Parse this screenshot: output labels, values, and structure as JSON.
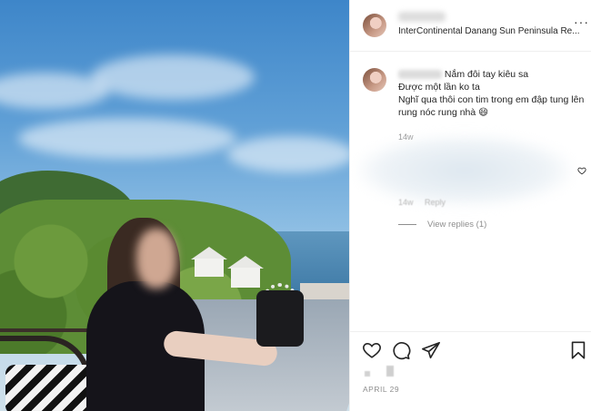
{
  "post": {
    "author": {
      "location": "InterContinental Danang Sun Peninsula Re..."
    },
    "more_label": "···",
    "caption": {
      "lines": [
        "Nắm đôi tay kiêu sa",
        "Được một lần ko ta",
        "Nghĩ qua thôi con tim trong em đập tung lên rung nóc rung nhà 😄"
      ],
      "time": "14w"
    },
    "comment": {
      "time": "14w",
      "reply_label": "Reply"
    },
    "view_replies_label": "View replies (1)",
    "date": "APRIL 29",
    "icons": {
      "like": "heart-icon",
      "comment": "comment-icon",
      "share": "share-icon",
      "save": "bookmark-icon",
      "more": "more-icon"
    }
  }
}
